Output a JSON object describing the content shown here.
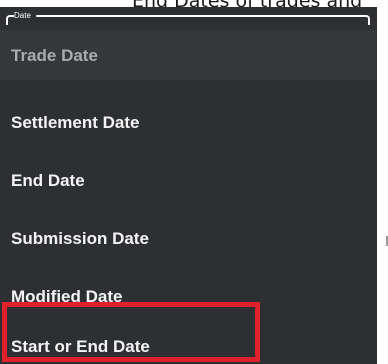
{
  "header_caption": "End Dates of trades and",
  "field": {
    "label": "Date"
  },
  "menu": {
    "hint": "Trade Date",
    "items": [
      "Settlement Date",
      "End Date",
      "Submission Date",
      "Modified Date",
      "Start or End Date"
    ]
  },
  "colors": {
    "menu_background": "#2d2f33",
    "highlight_border": "#e0202a",
    "text": "#f4f4f4",
    "hint_text": "#a9abaf"
  }
}
